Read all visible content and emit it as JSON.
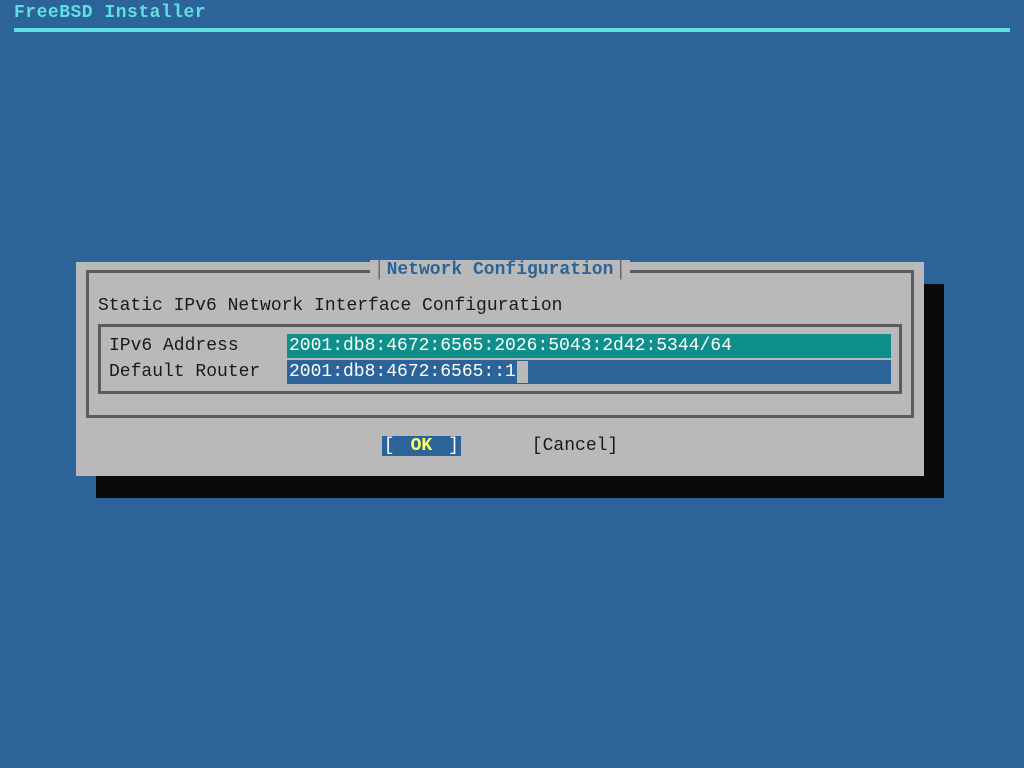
{
  "header": {
    "title": "FreeBSD Installer"
  },
  "dialog": {
    "title": "Network Configuration",
    "subtitle": "Static IPv6 Network Interface Configuration",
    "fields": [
      {
        "label": "IPv6 Address",
        "value": "2001:db8:4672:6565:2026:5043:2d42:5344/64"
      },
      {
        "label": "Default Router",
        "value": "2001:db8:4672:6565::1"
      }
    ],
    "buttons": {
      "ok": "OK",
      "cancel": "Cancel"
    }
  }
}
